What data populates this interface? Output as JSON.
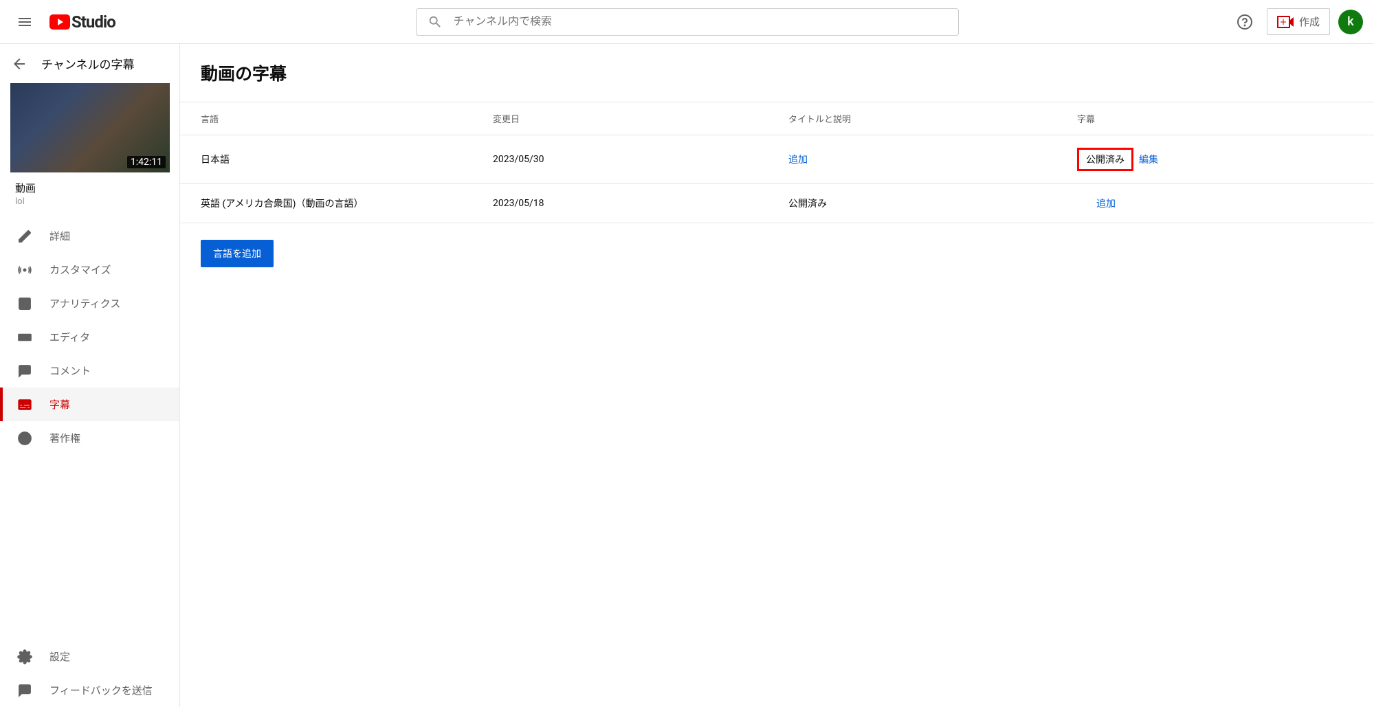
{
  "header": {
    "logo_text": "Studio",
    "search_placeholder": "チャンネル内で検索",
    "create_label": "作成",
    "avatar_letter": "k"
  },
  "sidebar": {
    "title": "チャンネルの字幕",
    "thumbnail_duration": "1:42:11",
    "video_heading": "動画",
    "video_name": "lol",
    "items": [
      {
        "label": "詳細"
      },
      {
        "label": "カスタマイズ"
      },
      {
        "label": "アナリティクス"
      },
      {
        "label": "エディタ"
      },
      {
        "label": "コメント"
      },
      {
        "label": "字幕"
      },
      {
        "label": "著作権"
      }
    ],
    "settings_label": "設定",
    "feedback_label": "フィードバックを送信"
  },
  "main": {
    "title": "動画の字幕",
    "columns": {
      "language": "言語",
      "modified": "変更日",
      "title_desc": "タイトルと説明",
      "subtitles": "字幕"
    },
    "rows": [
      {
        "language": "日本語",
        "modified": "2023/05/30",
        "title_desc_link": "追加",
        "subtitles_status": "公開済み",
        "subtitles_edit": "編集"
      },
      {
        "language": "英語 (アメリカ合衆国)（動画の言語）",
        "modified": "2023/05/18",
        "title_desc_text": "公開済み",
        "subtitles_add": "追加"
      }
    ],
    "add_language_btn": "言語を追加"
  }
}
